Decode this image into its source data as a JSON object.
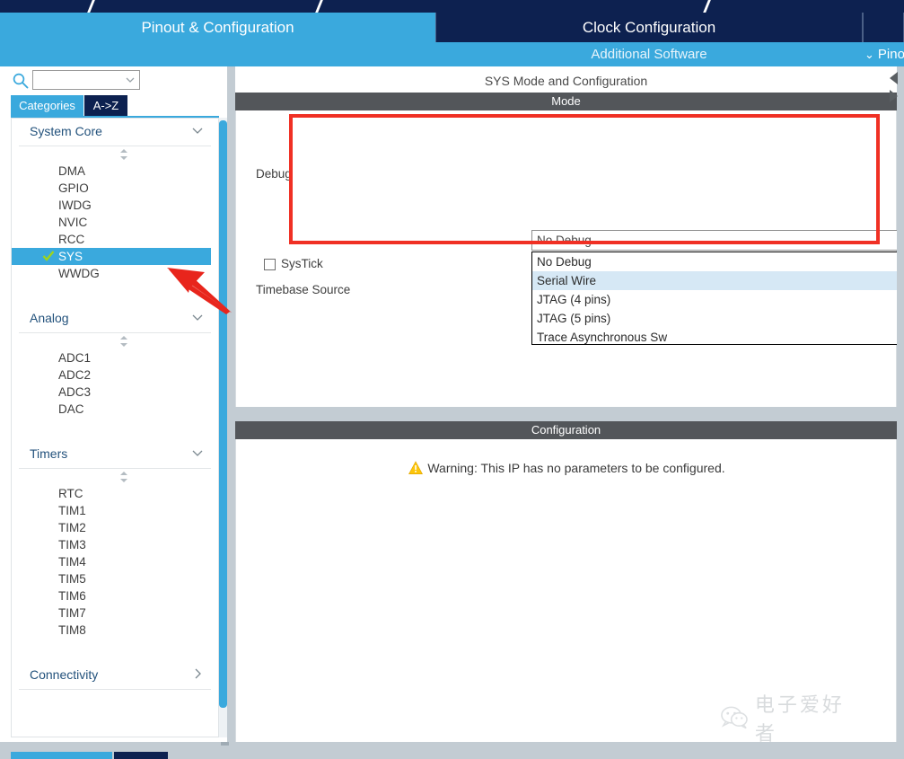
{
  "app": {
    "accent_cyan": "#3aa9dd",
    "accent_navy": "#0d2150",
    "annotation_red": "#f03024",
    "header_gray": "#53565a"
  },
  "tabs": [
    {
      "label": "Pinout & Configuration",
      "active": true
    },
    {
      "label": "Clock Configuration",
      "active": false
    },
    {
      "label": "",
      "active": false
    }
  ],
  "subbar": {
    "additional_software": "Additional Software",
    "pinout_view": "Pinout view",
    "chevron": "⌄"
  },
  "sidebar": {
    "search": {
      "value": "",
      "placeholder": ""
    },
    "icons": {
      "search": "search-icon",
      "gear": "gear-icon",
      "combo_arrow": "chevron-down-icon"
    },
    "mode_tabs": [
      {
        "label": "Categories",
        "active": true
      },
      {
        "label": "A->Z",
        "active": false
      }
    ],
    "groups": [
      {
        "title": "System Core",
        "expanded": true,
        "items": [
          {
            "label": "DMA",
            "selected": false,
            "checked": false
          },
          {
            "label": "GPIO",
            "selected": false,
            "checked": false
          },
          {
            "label": "IWDG",
            "selected": false,
            "checked": false
          },
          {
            "label": "NVIC",
            "selected": false,
            "checked": false
          },
          {
            "label": "RCC",
            "selected": false,
            "checked": false
          },
          {
            "label": "SYS",
            "selected": true,
            "checked": true
          },
          {
            "label": "WWDG",
            "selected": false,
            "checked": false
          }
        ]
      },
      {
        "title": "Analog",
        "expanded": true,
        "items": [
          {
            "label": "ADC1",
            "selected": false,
            "checked": false
          },
          {
            "label": "ADC2",
            "selected": false,
            "checked": false
          },
          {
            "label": "ADC3",
            "selected": false,
            "checked": false
          },
          {
            "label": "DAC",
            "selected": false,
            "checked": false
          }
        ]
      },
      {
        "title": "Timers",
        "expanded": true,
        "items": [
          {
            "label": "RTC",
            "selected": false,
            "checked": false
          },
          {
            "label": "TIM1",
            "selected": false,
            "checked": false
          },
          {
            "label": "TIM2",
            "selected": false,
            "checked": false
          },
          {
            "label": "TIM3",
            "selected": false,
            "checked": false
          },
          {
            "label": "TIM4",
            "selected": false,
            "checked": false
          },
          {
            "label": "TIM5",
            "selected": false,
            "checked": false
          },
          {
            "label": "TIM6",
            "selected": false,
            "checked": false
          },
          {
            "label": "TIM7",
            "selected": false,
            "checked": false
          },
          {
            "label": "TIM8",
            "selected": false,
            "checked": false
          }
        ]
      },
      {
        "title": "Connectivity",
        "expanded": false,
        "items": []
      }
    ]
  },
  "main": {
    "panel_title": "SYS Mode and Configuration",
    "mode_section": {
      "header": "Mode",
      "debug_label": "Debug",
      "debug_value": "No Debug",
      "systick_label": "SysTick",
      "timebase_label": "Timebase Source",
      "systick_checked": false,
      "dropdown_open": true,
      "dropdown_options": [
        {
          "label": "No Debug",
          "hovered": false
        },
        {
          "label": "Serial Wire",
          "hovered": true
        },
        {
          "label": "JTAG (4 pins)",
          "hovered": false
        },
        {
          "label": "JTAG (5 pins)",
          "hovered": false
        },
        {
          "label": "Trace Asynchronous Sw",
          "hovered": false
        }
      ]
    },
    "configuration_section": {
      "header": "Configuration",
      "warning_text": "Warning: This IP has no parameters to be configured.",
      "warning_icon": "warning-triangle-icon"
    }
  },
  "watermark": {
    "text": "电子爱好者",
    "icon": "wechat-icon"
  }
}
